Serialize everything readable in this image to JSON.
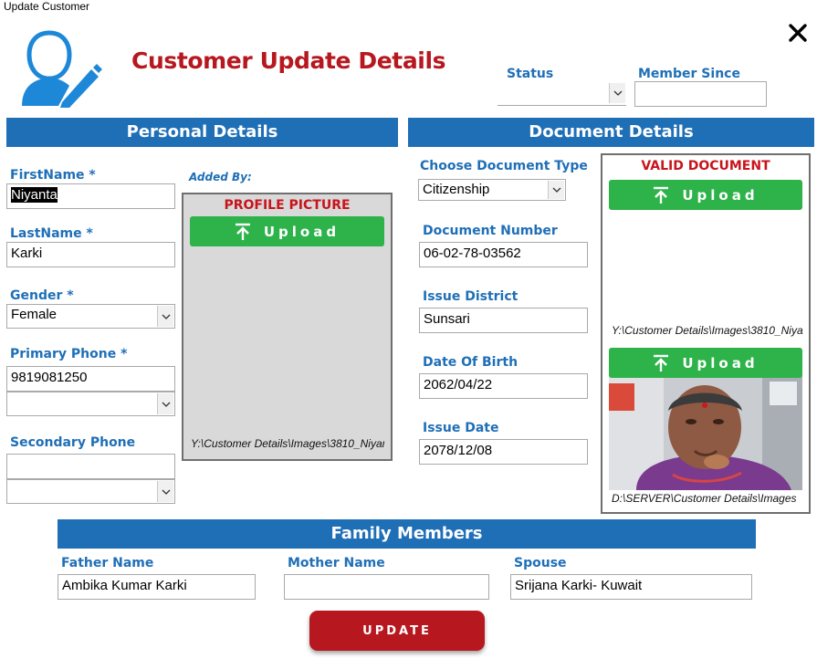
{
  "window": {
    "title": "Update Customer"
  },
  "header": {
    "title": "Customer Update Details",
    "close_icon": "close-icon"
  },
  "status": {
    "label": "Status",
    "value": ""
  },
  "member_since": {
    "label": "Member Since",
    "value": ""
  },
  "personal": {
    "title": "Personal Details",
    "first_name": {
      "label": "FirstName *",
      "value": "Niyanta"
    },
    "last_name": {
      "label": "LastName *",
      "value": "Karki"
    },
    "gender": {
      "label": "Gender *",
      "value": "Female"
    },
    "primary_phone": {
      "label": "Primary Phone *",
      "value": "9819081250",
      "type_value": ""
    },
    "secondary_phone": {
      "label": "Secondary Phone",
      "value": "",
      "type_value": ""
    },
    "added_by": "Added By:",
    "profile": {
      "caption": "PROFILE PICTURE",
      "upload_label": "Upload",
      "path": "Y:\\Customer Details\\Images\\3810_Niyanta"
    }
  },
  "document": {
    "title": "Document Details",
    "doc_type": {
      "label": "Choose Document Type",
      "value": "Citizenship"
    },
    "doc_number": {
      "label": "Document Number",
      "value": "06-02-78-03562"
    },
    "issue_district": {
      "label": "Issue District",
      "value": "Sunsari"
    },
    "dob": {
      "label": "Date Of Birth",
      "value": "2062/04/22"
    },
    "issue_date": {
      "label": "Issue Date",
      "value": "2078/12/08"
    },
    "valid": {
      "caption": "VALID DOCUMENT",
      "upload1_label": "Upload",
      "path1": "Y:\\Customer Details\\Images\\3810_Niyanta",
      "upload2_label": "Upload",
      "path2": "D:\\SERVER\\Customer Details\\Images"
    }
  },
  "family": {
    "title": "Family Members",
    "father": {
      "label": "Father Name",
      "value": "Ambika Kumar Karki"
    },
    "mother": {
      "label": "Mother Name",
      "value": ""
    },
    "spouse": {
      "label": "Spouse",
      "value": "Srijana Karki- Kuwait"
    }
  },
  "actions": {
    "update_label": "UPDATE"
  },
  "colors": {
    "brand_red": "#b7181f",
    "brand_blue": "#1f6fb7",
    "upload_green": "#2db34a"
  }
}
